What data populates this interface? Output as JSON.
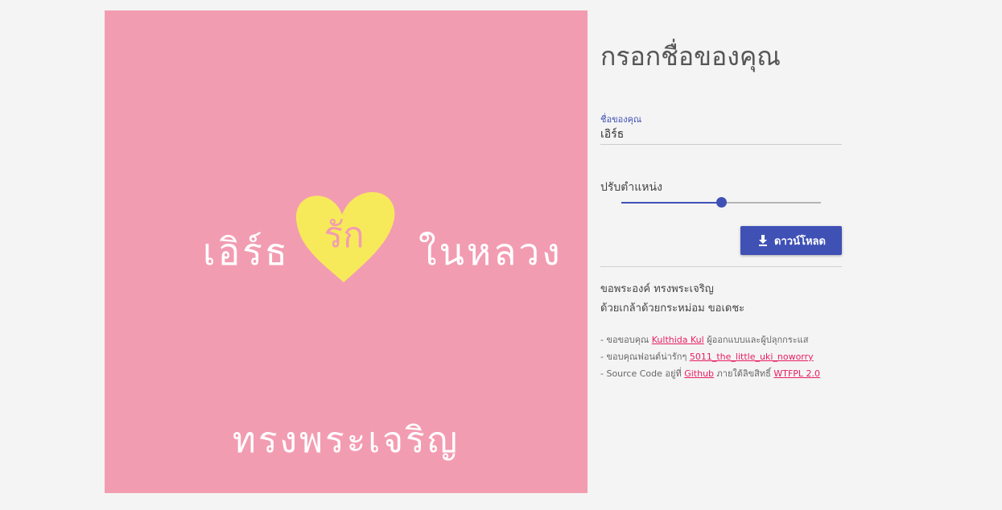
{
  "card": {
    "name": "เอิร์ธ",
    "heart_word": "รัก",
    "place": "ในหลวง",
    "bottom": "ทรงพระเจริญ",
    "background_color": "#f29cb2",
    "heart_color": "#f7ea5a"
  },
  "panel": {
    "title": "กรอกชื่อของคุณ",
    "name_field": {
      "label": "ชื่อของคุณ",
      "value": "เอิร์ธ"
    },
    "position_slider": {
      "label": "ปรับตำแหน่ง",
      "value_fraction": 0.5
    },
    "download_button": {
      "label": "ดาวน์โหลด",
      "icon": "download-icon"
    },
    "tribute_line1": "ขอพระองค์ ทรงพระเจริญ",
    "tribute_line2": "ด้วยเกล้าด้วยกระหม่อม ขอเดชะ",
    "credits": [
      {
        "prefix": "- ขอขอบคุณ ",
        "link": "Kulthida Kul",
        "suffix": " ผู้ออกแบบและผู้ปลุกกระแส",
        "link2": "",
        "suffix2": ""
      },
      {
        "prefix": "- ขอบคุณฟอนต์น่ารักๆ ",
        "link": "5011_the_little_uki_noworry",
        "suffix": "",
        "link2": "",
        "suffix2": ""
      },
      {
        "prefix": "- Source Code อยู่ที่ ",
        "link": "Github",
        "suffix": " ภายใต้ลิขสิทธิ์ ",
        "link2": "WTFPL 2.0",
        "suffix2": ""
      }
    ]
  },
  "colors": {
    "accent": "#3f51b5",
    "link": "#e91e63",
    "page_background": "#f4f4f4"
  }
}
